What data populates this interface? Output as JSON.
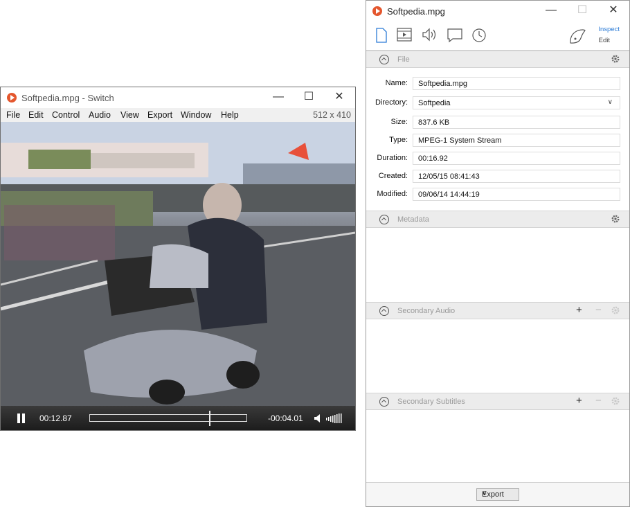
{
  "player": {
    "title": "Softpedia.mpg - Switch",
    "menu": [
      "File",
      "Edit",
      "Control",
      "Audio",
      "View",
      "Export",
      "Window",
      "Help"
    ],
    "resolution": "512 x 410",
    "elapsed": "00:12.87",
    "remaining": "-00:04.01",
    "progress_fraction": 0.76
  },
  "inspector": {
    "title": "Softpedia.mpg",
    "toolbar": {
      "inspect_label": "Inspect",
      "edit_label": "Edit"
    },
    "sections": {
      "file": "File",
      "metadata": "Metadata",
      "secondary_audio": "Secondary Audio",
      "secondary_subtitles": "Secondary Subtitles"
    },
    "fields": {
      "name": {
        "label": "Name:",
        "value": "Softpedia.mpg"
      },
      "directory": {
        "label": "Directory:",
        "value": "Softpedia"
      },
      "size": {
        "label": "Size:",
        "value": "837.6 KB"
      },
      "type": {
        "label": "Type:",
        "value": "MPEG-1 System Stream"
      },
      "duration": {
        "label": "Duration:",
        "value": "00:16.92"
      },
      "created": {
        "label": "Created:",
        "value": "12/05/15 08:41:43"
      },
      "modified": {
        "label": "Modified:",
        "value": "09/06/14 14:44:19"
      }
    },
    "export_label": "Export"
  },
  "colors": {
    "accent": "#e4572e",
    "link": "#2b7bd6",
    "section_bg": "#ececec"
  }
}
